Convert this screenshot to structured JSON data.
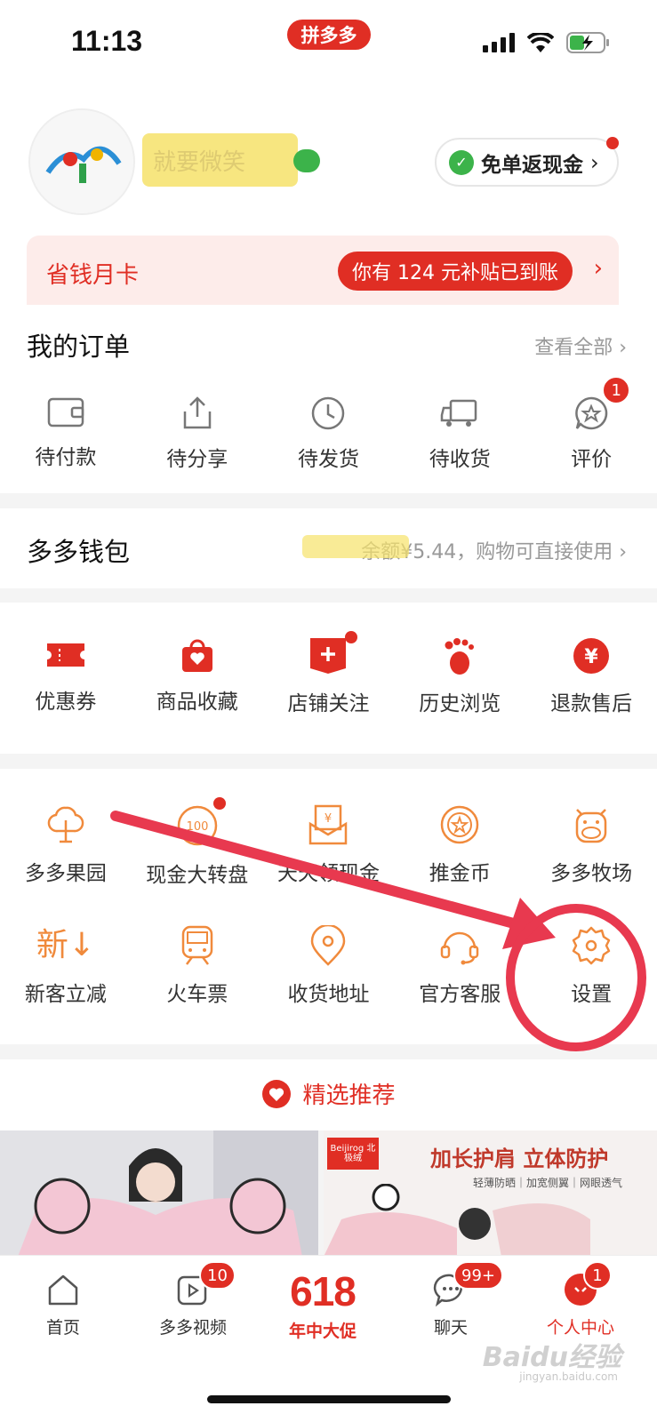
{
  "status": {
    "time": "11:13",
    "app_badge": "拼多多"
  },
  "profile": {
    "name_blurred": "就要微笑",
    "cashback_label": "免单返现金"
  },
  "savecard": {
    "title": "省钱月卡",
    "pill": "你有 124 元补贴已到账"
  },
  "orders": {
    "title": "我的订单",
    "more": "查看全部",
    "items": [
      {
        "label": "待付款",
        "icon": "wallet-icon"
      },
      {
        "label": "待分享",
        "icon": "share-icon"
      },
      {
        "label": "待发货",
        "icon": "clock-icon"
      },
      {
        "label": "待收货",
        "icon": "truck-icon"
      },
      {
        "label": "评价",
        "icon": "review-icon",
        "badge": "1"
      }
    ]
  },
  "wallet": {
    "title": "多多钱包",
    "more": "余额¥5.44，购物可直接使用"
  },
  "services": {
    "items": [
      {
        "label": "优惠券",
        "icon": "coupon-icon"
      },
      {
        "label": "商品收藏",
        "icon": "bag-heart-icon"
      },
      {
        "label": "店铺关注",
        "icon": "store-plus-icon"
      },
      {
        "label": "历史浏览",
        "icon": "footprint-icon"
      },
      {
        "label": "退款售后",
        "icon": "yen-icon"
      }
    ]
  },
  "tools": {
    "row1": [
      {
        "label": "多多果园",
        "icon": "tree-icon"
      },
      {
        "label": "现金大转盘",
        "icon": "wheel-icon"
      },
      {
        "label": "天天领现金",
        "icon": "cash-envelope-icon"
      },
      {
        "label": "推金币",
        "icon": "coin-icon"
      },
      {
        "label": "多多牧场",
        "icon": "cow-icon"
      }
    ],
    "row2": [
      {
        "label": "新客立减",
        "icon": "new-icon",
        "glyph": "新↓"
      },
      {
        "label": "火车票",
        "icon": "train-icon"
      },
      {
        "label": "收货地址",
        "icon": "location-icon"
      },
      {
        "label": "官方客服",
        "icon": "headset-icon"
      },
      {
        "label": "设置",
        "icon": "gear-icon"
      }
    ]
  },
  "recommend": {
    "title": "精选推荐",
    "product2_brand": "Beijirog 北极绒",
    "product2_headline": "加长护肩 立体防护",
    "product2_sub": "轻薄防晒｜加宽侧翼｜网眼透气"
  },
  "nav": {
    "items": [
      {
        "label": "首页"
      },
      {
        "label": "多多视频",
        "badge": "10"
      },
      {
        "label": "年中大促",
        "promo": "618"
      },
      {
        "label": "聊天",
        "badge": "99+"
      },
      {
        "label": "个人中心",
        "badge": "1"
      }
    ]
  },
  "watermark": {
    "main": "Baidu经验",
    "sub": "jingyan.baidu.com"
  },
  "colors": {
    "brand_red": "#e02e24",
    "orange": "#f08a3c",
    "wechat_green": "#3cb34a"
  }
}
